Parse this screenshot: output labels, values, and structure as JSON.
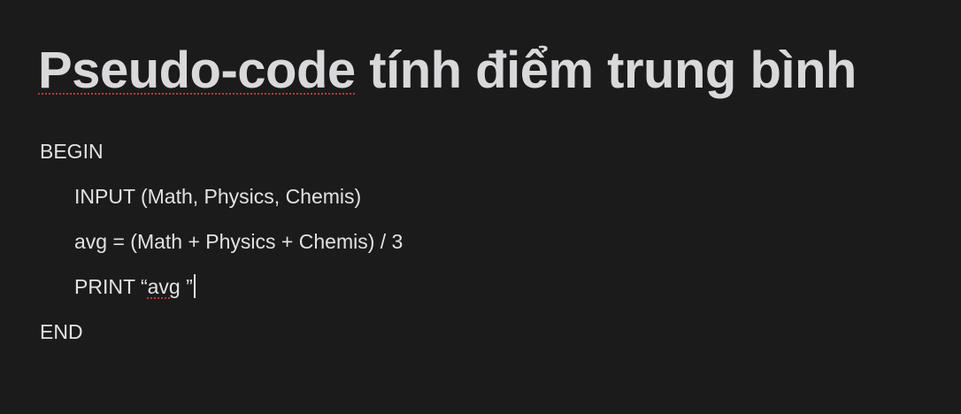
{
  "document": {
    "title": {
      "misspelled_word": "Pseudo-code",
      "rest": " tính điểm trung bình"
    },
    "lines": [
      {
        "text": "BEGIN"
      },
      {
        "text": "INPUT (Math, Physics, Chemis)"
      },
      {
        "text": "avg = (Math + Physics + Chemis) / 3"
      },
      {
        "prefix": "PRINT “",
        "misspelled_word": "avg",
        "suffix": " ”"
      },
      {
        "text": "END"
      }
    ]
  },
  "colors": {
    "background": "#1b1b1c",
    "title_text": "#d9d9db",
    "body_text": "#e2e2e4",
    "spellcheck_underline": "#c0392b"
  }
}
